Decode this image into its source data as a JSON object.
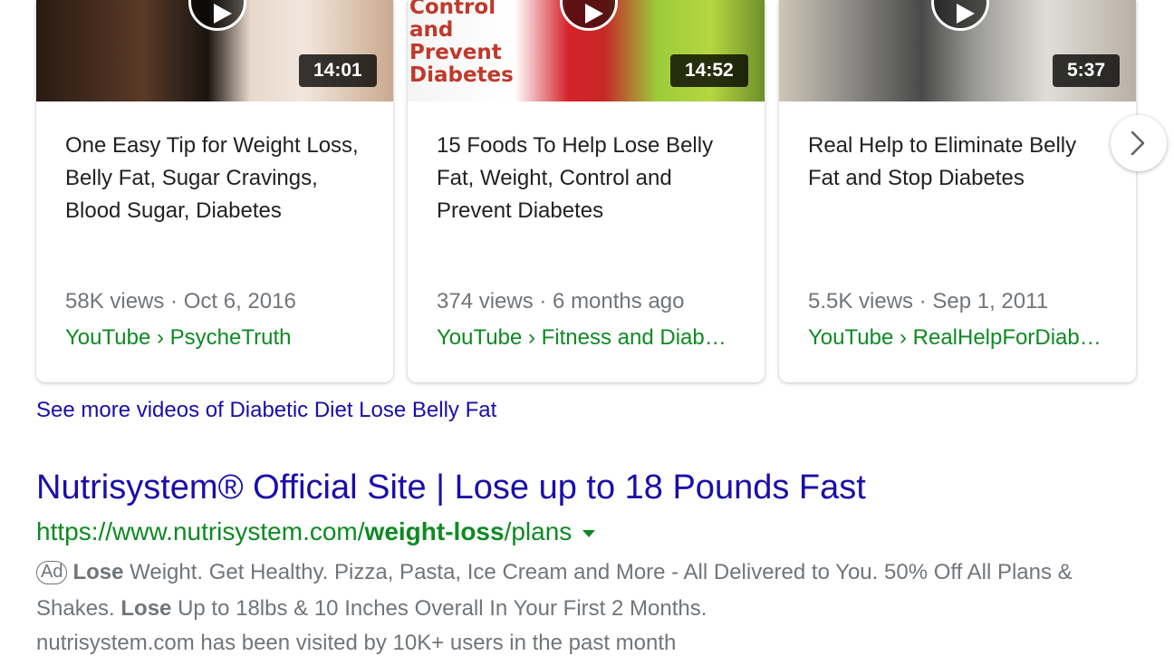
{
  "videos": [
    {
      "thumb_text": "",
      "duration": "14:01",
      "title": "One Easy Tip for Weight Loss, Belly Fat, Sugar Cravings, Blood Sugar, Diabetes",
      "meta": "58K views · Oct 6, 2016",
      "source": "YouTube › PsycheTruth"
    },
    {
      "thumb_text": "Control\nand\nPrevent\nDiabetes",
      "duration": "14:52",
      "title": "15 Foods To Help Lose Belly Fat, Weight, Control and Prevent Diabetes",
      "meta": "374 views · 6 months ago",
      "source": "YouTube › Fitness and Diabetes"
    },
    {
      "thumb_text": "",
      "duration": "5:37",
      "title": "Real Help to Eliminate Belly Fat and Stop Diabetes",
      "meta": "5.5K views · Sep 1, 2011",
      "source": "YouTube › RealHelpForDiabetes"
    }
  ],
  "see_more": "See more videos of Diabetic Diet Lose Belly Fat",
  "ad": {
    "title": "Nutrisystem® Official Site | Lose up to 18 Pounds Fast",
    "url_prefix": "https://www.nutrisystem.com/",
    "url_bold": "weight-loss",
    "url_suffix": "/plans",
    "badge": "Ad",
    "desc_lose1": "Lose",
    "desc_part1": " Weight. Get Healthy. Pizza, Pasta, Ice Cream and More - All Delivered to You. 50% Off All Plans & Shakes. ",
    "desc_lose2": "Lose",
    "desc_part2": " Up to 18lbs & 10 Inches Overall In Your First 2 Months.",
    "visits": "nutrisystem.com has been visited by 10K+ users in the past month"
  },
  "icons": {
    "play": "play-icon",
    "next": "chevron-right-icon",
    "caret": "caret-down-icon"
  }
}
